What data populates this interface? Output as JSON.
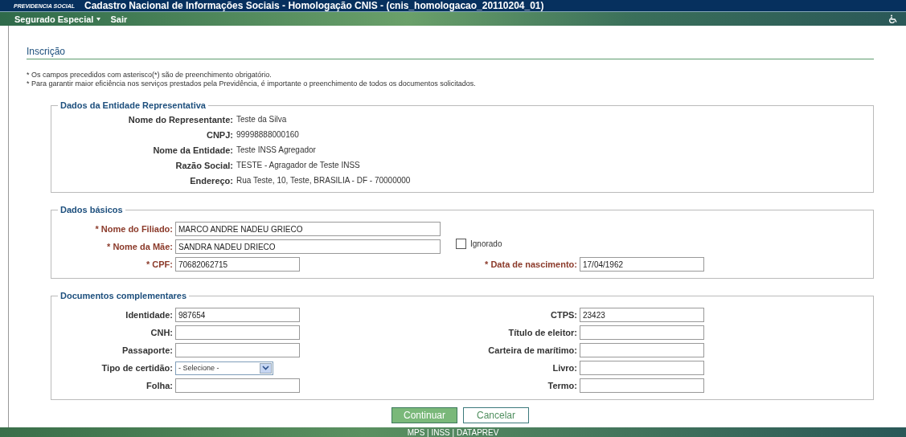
{
  "header": {
    "brand": "PREVIDENCIA SOCIAL",
    "title": "Cadastro Nacional de Informações Sociais - Homologação CNIS - (cnis_homologacao_20110204_01)"
  },
  "menu": [
    {
      "label": "Segurado Especial",
      "has_dropdown": true
    },
    {
      "label": "Sair",
      "has_dropdown": false
    }
  ],
  "page_title": "Inscrição",
  "notes": [
    "* Os campos precedidos com asterisco(*) são de preenchimento obrigatório.",
    "* Para garantir maior eficiência nos serviços prestados pela Previdência, é importante o preenchimento de todos os documentos solicitados."
  ],
  "entity_section": {
    "legend": "Dados da Entidade Representativa",
    "rows": [
      {
        "label": "Nome do Representante:",
        "value": "Teste da Silva"
      },
      {
        "label": "CNPJ:",
        "value": "99998888000160"
      },
      {
        "label": "Nome da Entidade:",
        "value": "Teste INSS Agregador"
      },
      {
        "label": "Razão Social:",
        "value": "TESTE - Agragador de Teste INSS"
      },
      {
        "label": "Endereço:",
        "value": "Rua Teste, 10, Teste, BRASILIA - DF - 70000000"
      }
    ]
  },
  "basic_section": {
    "legend": "Dados básicos",
    "rows": [
      [
        {
          "kind": "wide",
          "label": "* Nome do Filiado:",
          "required": true,
          "value": "MARCO ANDRE NADEU GRIECO"
        }
      ],
      [
        {
          "kind": "wide",
          "label": "* Nome da Mãe:",
          "required": true,
          "value": "SANDRA NADEU DRIECO"
        },
        {
          "kind": "checkbox",
          "label": "Ignorado",
          "checked": false
        }
      ],
      [
        {
          "kind": "text",
          "label": "* CPF:",
          "required": true,
          "value": "70682062715"
        },
        {
          "kind": "text",
          "label": "* Data de nascimento:",
          "required": true,
          "value": "17/04/1962"
        }
      ]
    ]
  },
  "docs_section": {
    "legend": "Documentos complementares",
    "rows": [
      [
        {
          "kind": "text",
          "label": "Identidade:",
          "required": false,
          "value": "987654"
        },
        {
          "kind": "text",
          "label": "CTPS:",
          "required": false,
          "value": "23423"
        }
      ],
      [
        {
          "kind": "text",
          "label": "CNH:",
          "required": false
        },
        {
          "kind": "text",
          "label": "Título de eleitor:",
          "required": false
        }
      ],
      [
        {
          "kind": "text",
          "label": "Passaporte:",
          "required": false
        },
        {
          "kind": "text",
          "label": "Carteira de marítimo:",
          "required": false
        }
      ],
      [
        {
          "kind": "select",
          "label": "Tipo de certidão:",
          "required": false,
          "value": "- Selecione -"
        },
        {
          "kind": "text",
          "label": "Livro:",
          "required": false
        }
      ],
      [
        {
          "kind": "text",
          "label": "Folha:",
          "required": false
        },
        {
          "kind": "text",
          "label": "Termo:",
          "required": false
        }
      ]
    ]
  },
  "buttons": [
    {
      "label": "Continuar",
      "primary": true
    },
    {
      "label": "Cancelar",
      "primary": false
    }
  ],
  "footer": "MPS | INSS | DATAPREV"
}
